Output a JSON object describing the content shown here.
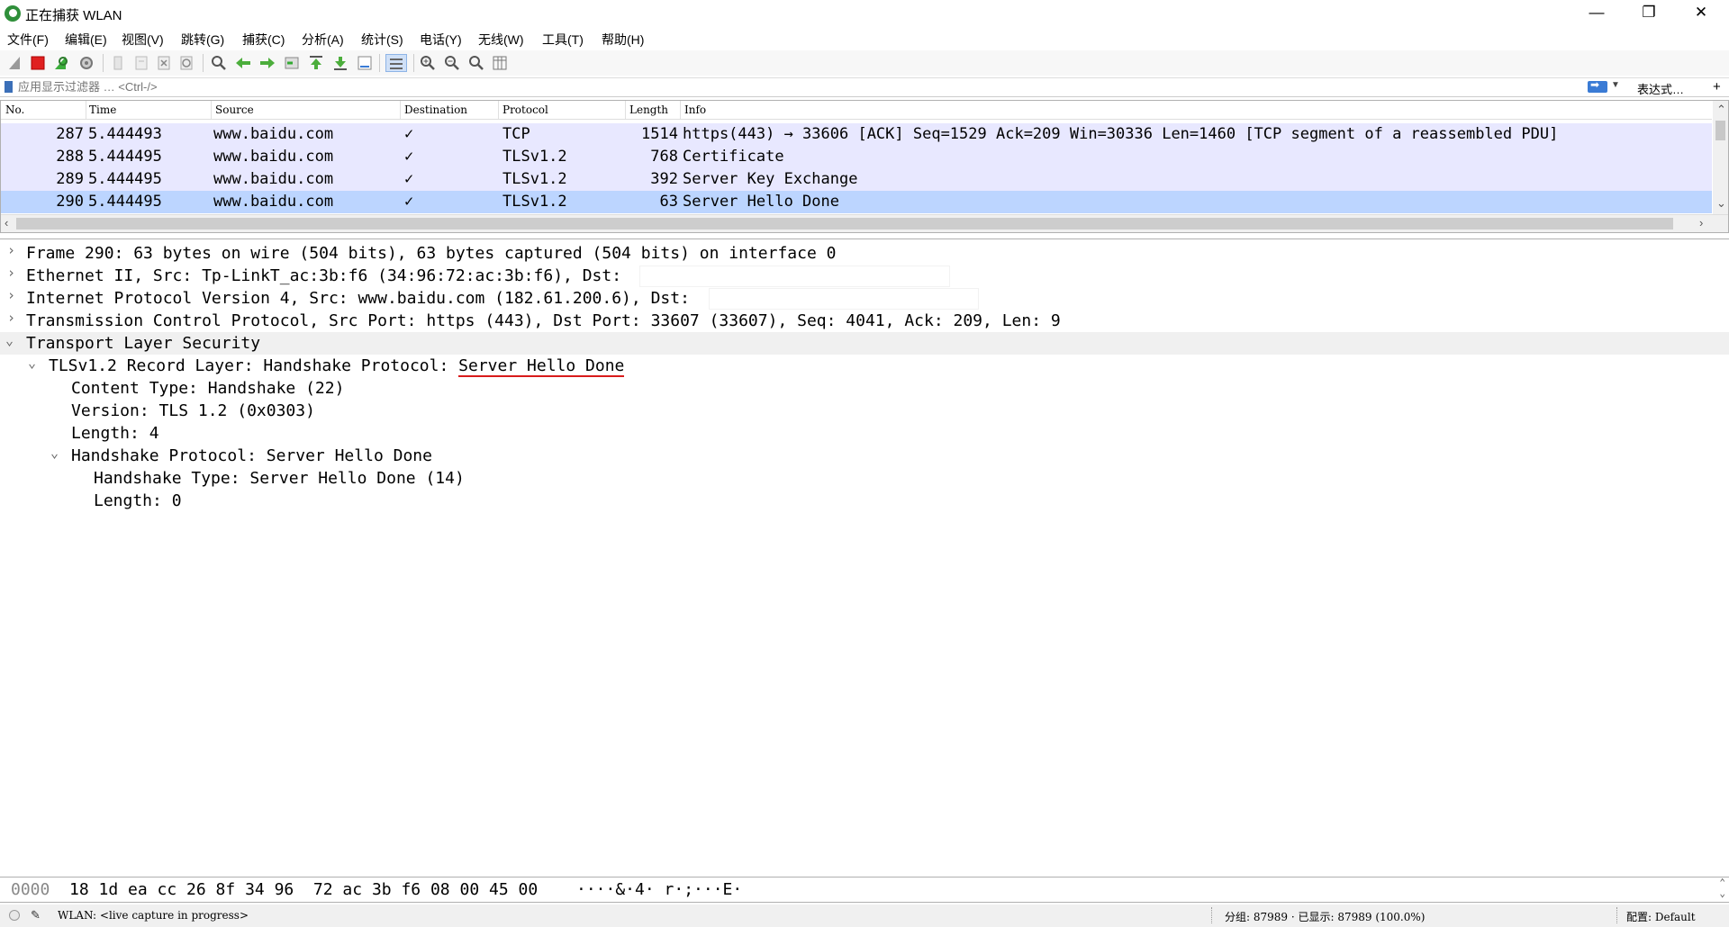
{
  "window": {
    "title": "正在捕获 WLAN",
    "minimize": "—",
    "restore": "❐",
    "close": "✕"
  },
  "menu": [
    "文件(F)",
    "编辑(E)",
    "视图(V)",
    "跳转(G)",
    "捕获(C)",
    "分析(A)",
    "统计(S)",
    "电话(Y)",
    "无线(W)",
    "工具(T)",
    "帮助(H)"
  ],
  "filter": {
    "placeholder": "应用显示过滤器 … <Ctrl-/>",
    "expression_label": "表达式…",
    "add_label": "+"
  },
  "packet_list": {
    "columns": [
      "No.",
      "Time",
      "Source",
      "Destination",
      "Protocol",
      "Length",
      "Info"
    ],
    "rows": [
      {
        "no": "287",
        "time": "5.444493",
        "source": "www.baidu.com",
        "dest": "✓",
        "protocol": "TCP",
        "length": "1514",
        "info": "https(443) → 33606 [ACK] Seq=1529 Ack=209 Win=30336 Len=1460 [TCP segment of a reassembled PDU]"
      },
      {
        "no": "288",
        "time": "5.444495",
        "source": "www.baidu.com",
        "dest": "✓",
        "protocol": "TLSv1.2",
        "length": "768",
        "info": "Certificate"
      },
      {
        "no": "289",
        "time": "5.444495",
        "source": "www.baidu.com",
        "dest": "✓",
        "protocol": "TLSv1.2",
        "length": "392",
        "info": "Server Key Exchange"
      },
      {
        "no": "290",
        "time": "5.444495",
        "source": "www.baidu.com",
        "dest": "✓",
        "protocol": "TLSv1.2",
        "length": "63",
        "info": "Server Hello Done"
      }
    ]
  },
  "details": {
    "frame": "Frame 290: 63 bytes on wire (504 bits), 63 bytes captured (504 bits) on interface 0",
    "ethernet": "Ethernet II, Src: Tp-LinkT_ac:3b:f6 (34:96:72:ac:3b:f6), Dst:",
    "ip": "Internet Protocol Version 4, Src: www.baidu.com (182.61.200.6), Dst:",
    "tcp": "Transmission Control Protocol, Src Port: https (443), Dst Port: 33607 (33607), Seq: 4041, Ack: 209, Len: 9",
    "tls": "Transport Layer Security",
    "record_prefix": "TLSv1.2 Record Layer: Handshake Protocol: ",
    "record_highlight": "Server Hello Done",
    "content_type": "Content Type: Handshake (22)",
    "version": "Version: TLS 1.2 (0x0303)",
    "length": "Length: 4",
    "handshake_protocol": "Handshake Protocol: Server Hello Done",
    "handshake_type": "Handshake Type: Server Hello Done (14)",
    "handshake_length": "Length: 0"
  },
  "bytes": {
    "offset": "0000",
    "hex": "18 1d ea cc 26 8f 34 96  72 ac 3b f6 08 00 45 00",
    "ascii": "····&·4· r·;···E·"
  },
  "status": {
    "capture": "WLAN: <live capture in progress>",
    "counts": "分组: 87989 · 已显示: 87989 (100.0%)",
    "profile": "配置: Default"
  },
  "icons": [
    "shark-fin-icon",
    "stop-icon",
    "restart-icon",
    "options-gear-icon",
    "open-file-icon",
    "save-file-icon",
    "close-file-icon",
    "reload-icon",
    "find-icon",
    "back-arrow-icon",
    "forward-arrow-icon",
    "goto-packet-icon",
    "first-packet-icon",
    "last-packet-icon",
    "autoscroll-icon",
    "colorize-icon",
    "zoom-in-icon",
    "zoom-out-icon",
    "zoom-normal-icon",
    "resize-columns-icon"
  ]
}
